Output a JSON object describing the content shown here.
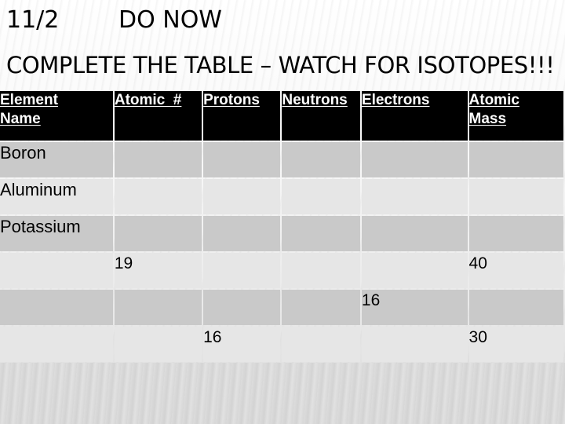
{
  "slide": {
    "date": "11/2",
    "heading": "DO NOW",
    "instruction": "COMPLETE THE TABLE – WATCH FOR ISOTOPES!!!"
  },
  "table": {
    "headers": [
      "Element Name",
      "Atomic  #",
      "Protons",
      "Neutrons",
      "Electrons",
      "Atomic Mass"
    ],
    "header_lines": [
      [
        "Element",
        "Name"
      ],
      [
        "Atomic  #"
      ],
      [
        "Protons"
      ],
      [
        "Neutrons"
      ],
      [
        "Electrons"
      ],
      [
        "Atomic",
        "Mass"
      ]
    ],
    "rows": [
      [
        "Boron",
        "",
        "",
        "",
        "",
        ""
      ],
      [
        "Aluminum",
        "",
        "",
        "",
        "",
        ""
      ],
      [
        "Potassium",
        "",
        "",
        "",
        "",
        ""
      ],
      [
        "",
        "19",
        "",
        "",
        "",
        "40"
      ],
      [
        "",
        "",
        "",
        "",
        "16",
        ""
      ],
      [
        "",
        "",
        "16",
        "",
        "",
        "30"
      ]
    ],
    "colors": {
      "header_bg": "#000000",
      "header_text": "#ffffff",
      "row_dark": "#c9c9c9",
      "row_light": "#e6e6e6"
    }
  }
}
